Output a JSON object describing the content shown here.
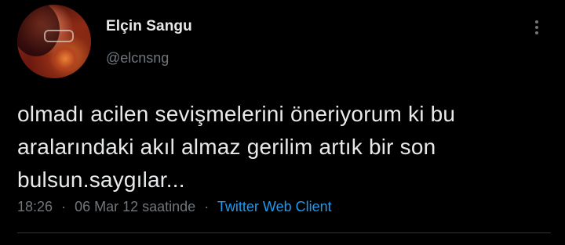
{
  "tweet": {
    "author_name": "Elçin Sangu",
    "handle": "@elcnsng",
    "text": "olmadı acilen sevişmelerini öneriyorum ki bu\naralarındaki akıl almaz gerilim artık bir son\nbulsun.saygılar...",
    "time": "18:26",
    "date": "06 Mar 12 saatinde",
    "separator": "·",
    "client": "Twitter Web Client"
  },
  "icons": {
    "more": "more-vertical-icon",
    "avatar": "profile-photo"
  },
  "colors": {
    "background": "#000000",
    "primary_text": "#e7e9ea",
    "secondary_text": "#71767b",
    "link": "#1d9bf0",
    "divider": "#2f3336"
  }
}
